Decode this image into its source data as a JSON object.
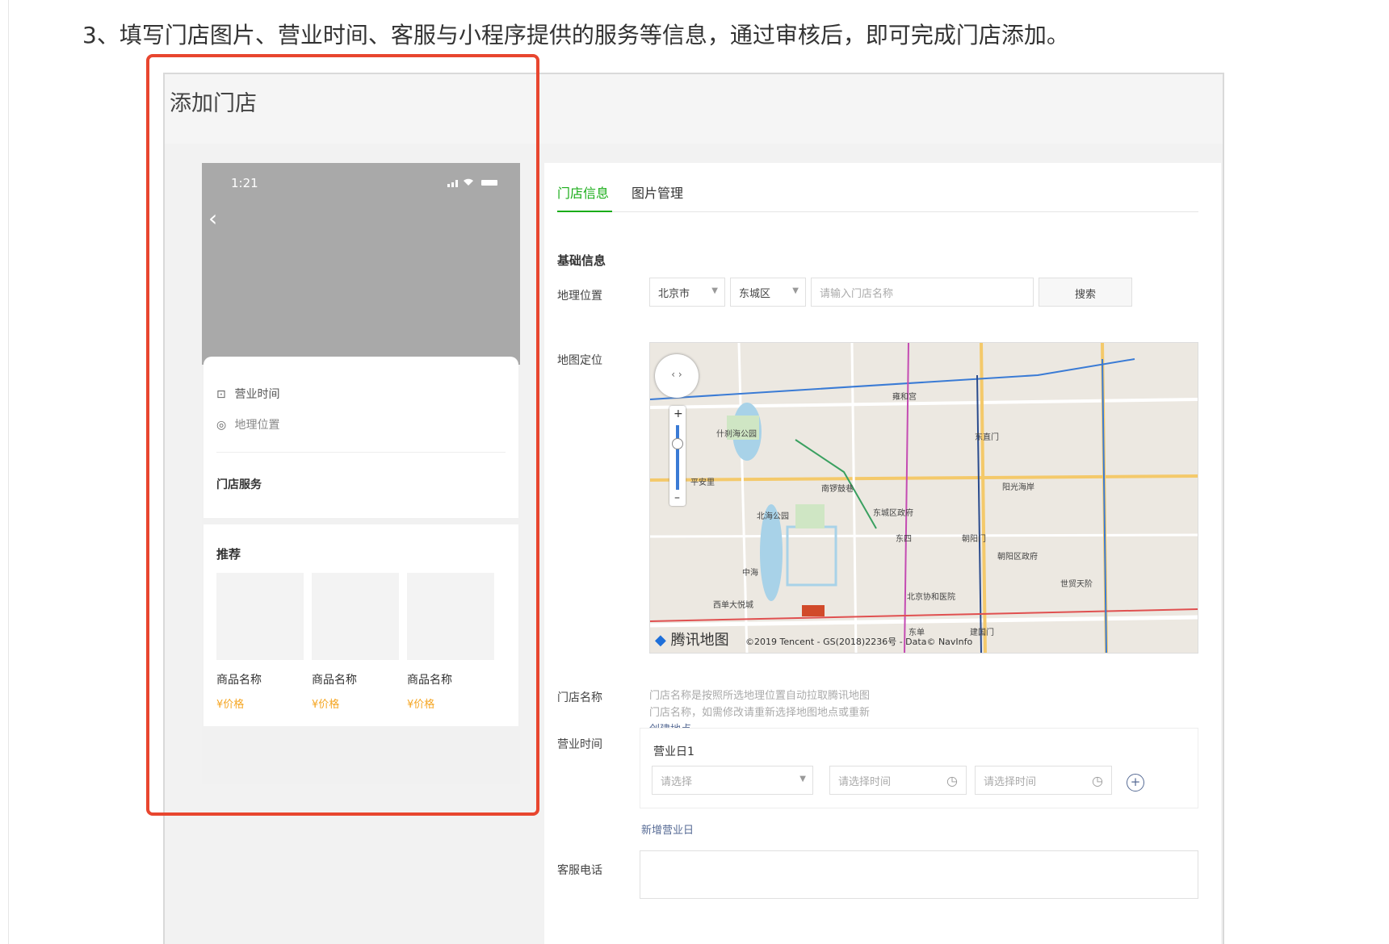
{
  "instruction": "3、填写门店图片、营业时间、客服与小程序提供的服务等信息，通过审核后，即可完成门店添加。",
  "screenshot": {
    "title": "添加门店",
    "phone": {
      "time": "1:21",
      "status_icons": "signal-wifi-battery",
      "business_hours_label": "营业时间",
      "location_label": "地理位置",
      "store_services_label": "门店服务",
      "recommend_title": "推荐",
      "goods": [
        {
          "name": "商品名称",
          "price": "¥价格"
        },
        {
          "name": "商品名称",
          "price": "¥价格"
        },
        {
          "name": "商品名称",
          "price": "¥价格"
        }
      ]
    },
    "form": {
      "tabs": [
        {
          "label": "门店信息",
          "active": true
        },
        {
          "label": "图片管理",
          "active": false
        }
      ],
      "section_title": "基础信息",
      "location_label": "地理位置",
      "city_value": "北京市",
      "district_value": "东城区",
      "store_name_placeholder": "请输入门店名称",
      "search_button": "搜索",
      "map_label": "地图定位",
      "map": {
        "logo": "腾讯地图",
        "copyright": "©2019 Tencent - GS(2018)2236号 - Data© NavInfo",
        "places": [
          "什刹海公园",
          "北海公园",
          "平安里",
          "南锣鼓巷",
          "东城区政府",
          "东四",
          "朝阳门",
          "朝阳区政府",
          "雍和宫",
          "东直门",
          "北京协和医院",
          "西单大悦城",
          "建国门",
          "东单",
          "阳光海岸",
          "世贸天阶",
          "中海"
        ]
      },
      "store_name_label": "门店名称",
      "store_name_hint": "门店名称是按照所选地理位置自动拉取腾讯地图门店名称，如需修改请重新选择地图地点或重新",
      "store_name_link": "创建地点",
      "business_hours_label": "营业时间",
      "business_day_title": "营业日1",
      "day_select_placeholder": "请选择",
      "start_time_placeholder": "请选择时间",
      "end_time_placeholder": "请选择时间",
      "add_day_link": "新增营业日",
      "service_phone_label": "客服电话"
    }
  },
  "colors": {
    "accent_green": "#1aad19",
    "link_blue": "#576b95",
    "highlight_red": "#e8462f",
    "price_orange": "#f5a623"
  }
}
